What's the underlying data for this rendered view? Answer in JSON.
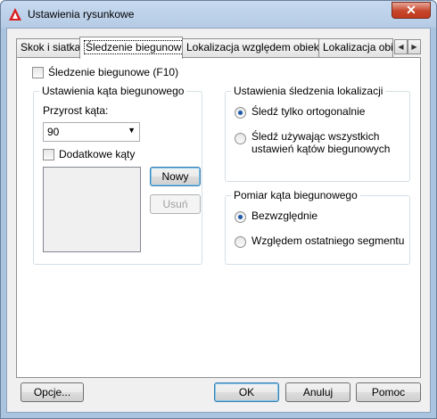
{
  "window": {
    "title": "Ustawienia rysunkowe",
    "close_glyph": "✕"
  },
  "tabs": [
    {
      "label": "Skok i siatka"
    },
    {
      "label": "Śledzenie biegunowe"
    },
    {
      "label": "Lokalizacja względem obiektu"
    },
    {
      "label": "Lokalizacja obiek"
    }
  ],
  "tab_scroll": {
    "left": "◀",
    "right": "▶"
  },
  "polar": {
    "enable_label": "Śledzenie biegunowe (F10)",
    "enabled": false
  },
  "angle_group": {
    "title": "Ustawienia kąta biegunowego",
    "increment_label": "Przyrost kąta:",
    "increment_value": "90",
    "additional_label": "Dodatkowe kąty",
    "additional_checked": false,
    "new_button": "Nowy",
    "delete_button": "Usuń"
  },
  "tracking_group": {
    "title": "Ustawienia śledzenia lokalizacji",
    "option1": "Śledź tylko ortogonalnie",
    "option2_line1": "Śledź używając wszystkich",
    "option2_line2": "ustawień kątów biegunowych",
    "selected": 1
  },
  "measure_group": {
    "title": "Pomiar kąta biegunowego",
    "option1": "Bezwzględnie",
    "option2": "Względem ostatniego segmentu",
    "selected": 1
  },
  "footer": {
    "options_button": "Opcje...",
    "ok_button": "OK",
    "cancel_button": "Anuluj",
    "help_button": "Pomoc"
  },
  "colors": {
    "titlebar": "#b5cbe5",
    "close": "#c7462b",
    "accent_icon": "#e02020"
  },
  "icons": {
    "app": "autocad-triangle-icon"
  }
}
